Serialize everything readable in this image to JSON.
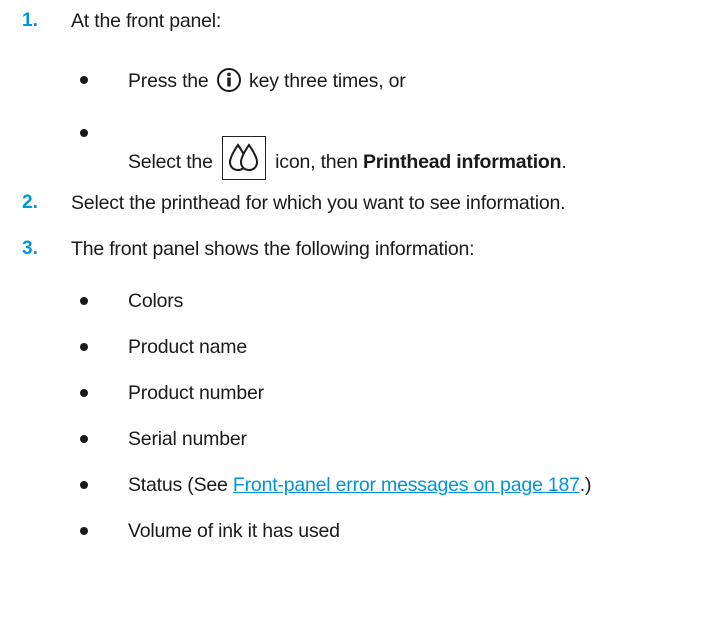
{
  "steps": [
    {
      "number": "1.",
      "text": "At the front panel:",
      "options": [
        {
          "prefix": "Press the",
          "icon": "info-icon",
          "suffix": "key three times, or"
        },
        {
          "prefix": "Select the",
          "icon": "ink-drops-icon",
          "middle": "icon, then",
          "bold": "Printhead information",
          "suffix": "."
        }
      ]
    },
    {
      "number": "2.",
      "text": "Select the printhead for which you want to see information."
    },
    {
      "number": "3.",
      "text": "The front panel shows the following information:",
      "items": [
        "Colors",
        "Product name",
        "Product number",
        "Serial number"
      ],
      "status_item": {
        "prefix": "Status (See",
        "link": "Front-panel error messages on page 187",
        "suffix": ".)"
      },
      "last_item": "Volume of ink it has used"
    }
  ],
  "colors": {
    "accent": "#0096d6",
    "text": "#1a1a1a"
  }
}
